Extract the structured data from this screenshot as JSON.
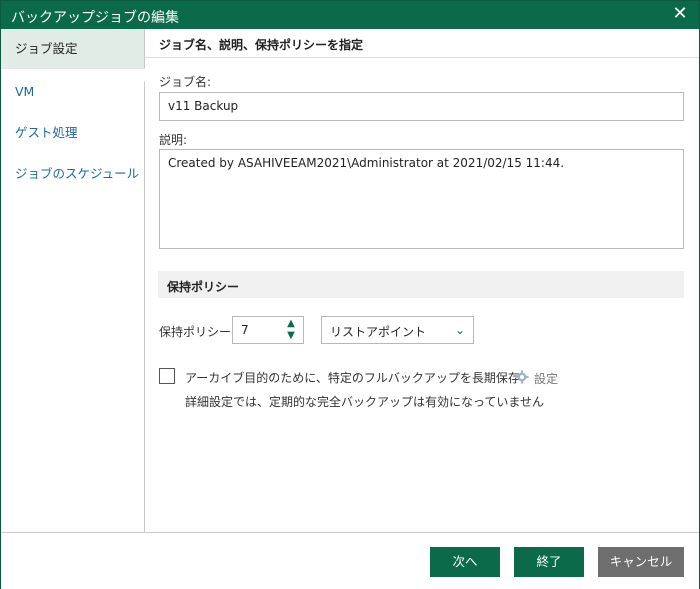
{
  "window": {
    "title": "バックアップジョブの編集",
    "close_glyph": "✕"
  },
  "sidebar": {
    "items": [
      {
        "label": "ジョブ設定",
        "active": true
      },
      {
        "label": "VM",
        "active": false
      },
      {
        "label": "ゲスト処理",
        "active": false
      },
      {
        "label": "ジョブのスケジュール",
        "active": false
      }
    ]
  },
  "main": {
    "section_title": "ジョブ名、説明、保持ポリシーを指定",
    "job_name_label": "ジョブ名:",
    "job_name_value": "v11 Backup",
    "description_label": "説明:",
    "description_value": "Created by ASAHIVEEAM2021\\Administrator at 2021/02/15 11:44.",
    "retention_group_title": "保持ポリシー",
    "retention_label": "保持ポリシー:",
    "retention_value": "7",
    "retention_unit": "リストアポイント",
    "archive_checkbox_label": "アーカイブ目的のために、特定のフルバックアップを長期保存",
    "archive_checked": false,
    "archive_settings_label": "設定",
    "archive_note": "詳細設定では、定期的な完全バックアップは有効になっていません"
  },
  "footer": {
    "next_label": "次へ",
    "finish_label": "終了",
    "cancel_label": "キャンセル"
  },
  "colors": {
    "accent": "#0b6a4a",
    "link": "#1a6aa0",
    "cancel": "#6e6e6e",
    "active_nav": "#e2ece6"
  }
}
